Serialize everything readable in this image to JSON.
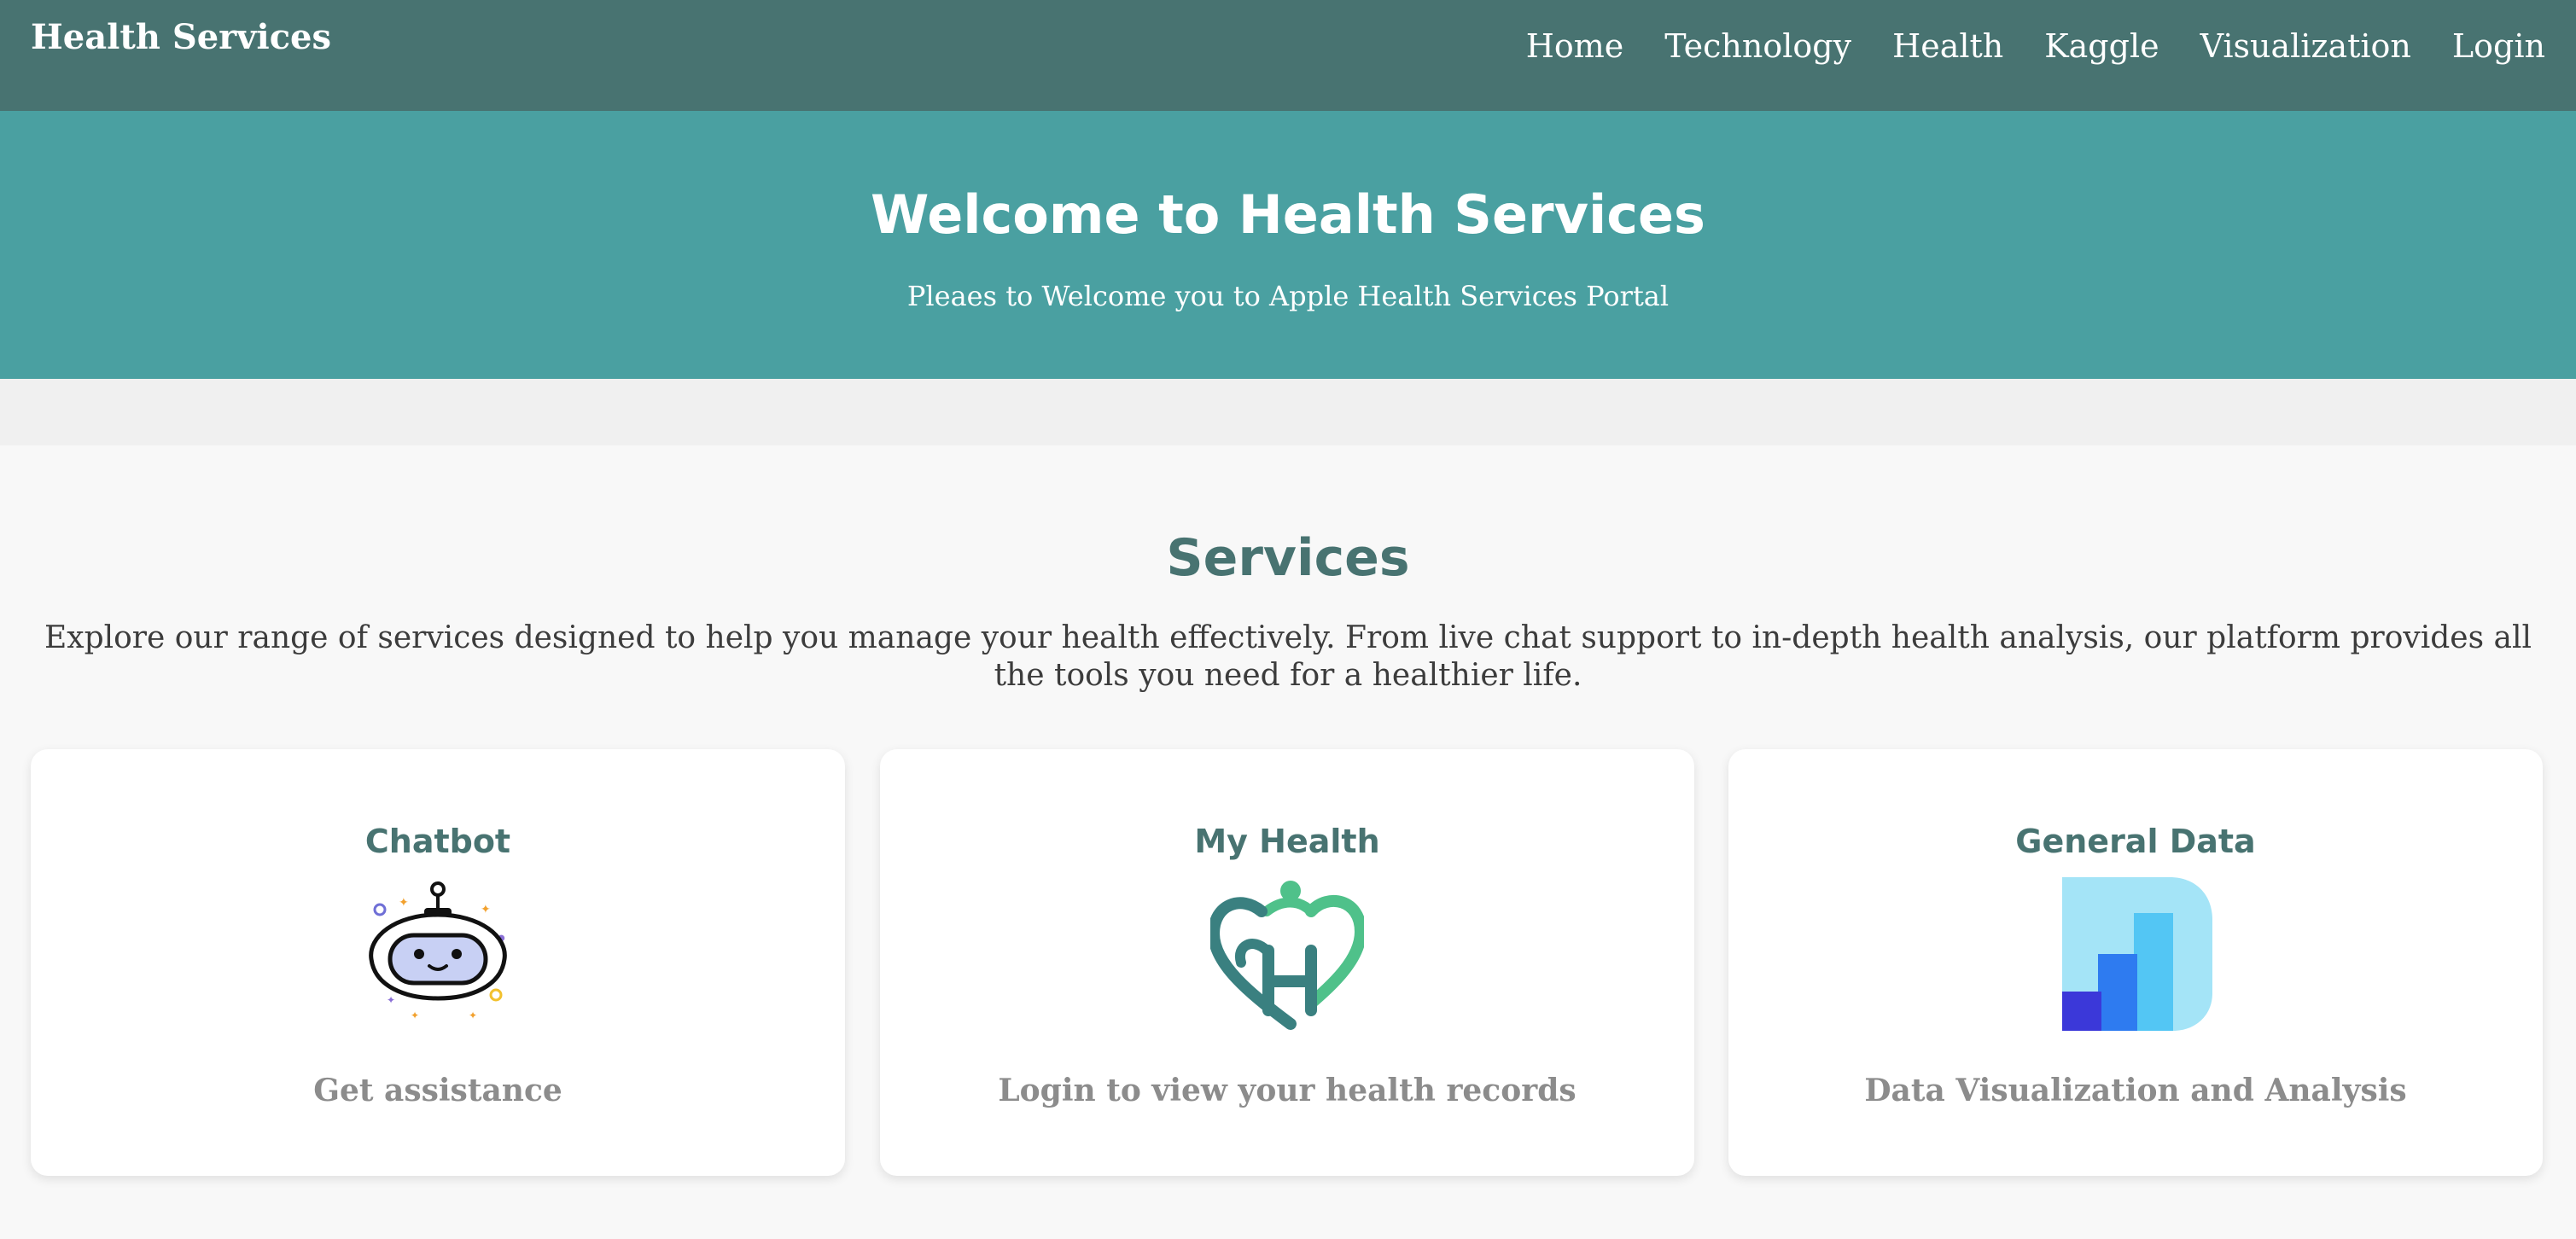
{
  "brand": "Health Services",
  "nav": {
    "items": [
      "Home",
      "Technology",
      "Health",
      "Kaggle",
      "Visualization",
      "Login"
    ]
  },
  "hero": {
    "title": "Welcome to Health Services",
    "subtitle": "Pleaes to Welcome you to Apple Health Services Portal"
  },
  "services": {
    "title": "Services",
    "description": "Explore our range of services designed to help you manage your health effectively. From live chat support to in-depth health analysis, our platform provides all the tools you need for a healthier life.",
    "cards": [
      {
        "title": "Chatbot",
        "subtitle": "Get assistance",
        "icon": "robot-icon"
      },
      {
        "title": "My Health",
        "subtitle": "Login to view your health records",
        "icon": "heart-h-icon"
      },
      {
        "title": "General Data",
        "subtitle": "Data Visualization and Analysis",
        "icon": "bar-chart-icon"
      }
    ]
  },
  "colors": {
    "navbar": "#487371",
    "hero": "#4aa0a1",
    "accent_text": "#487371",
    "muted_text": "#8c8c8c"
  }
}
